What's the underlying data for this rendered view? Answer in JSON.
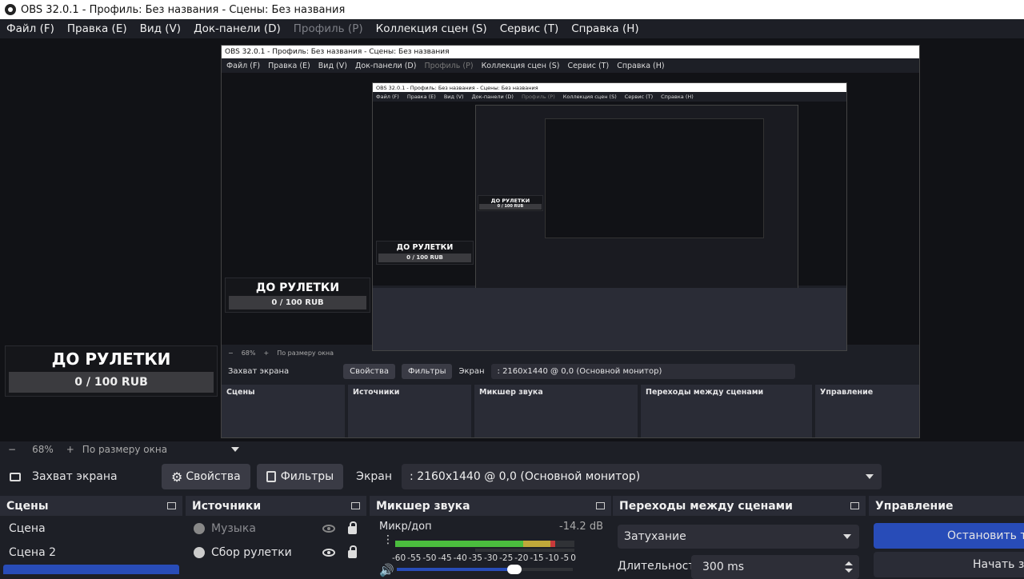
{
  "window": {
    "title": "OBS 32.0.1 - Профиль: Без названия - Сцены: Без названия"
  },
  "menu": [
    "Файл (F)",
    "Правка (E)",
    "Вид (V)",
    "Док-панели (D)",
    "Профиль (P)",
    "Коллекция сцен (S)",
    "Сервис (T)",
    "Справка (H)"
  ],
  "menu_disabled_index": 4,
  "overlay": {
    "heading": "ДО РУЛЕТКИ",
    "progress": "0 / 100 RUB"
  },
  "zoom": {
    "minus": "−",
    "value": "68%",
    "plus": "+",
    "mode": "По размеру окна"
  },
  "source_toolbar": {
    "source_name": "Захват экрана",
    "properties_label": "Свойства",
    "filters_label": "Фильтры",
    "screen_label": "Экран",
    "screen_value": ": 2160x1440 @ 0,0 (Основной монитор)"
  },
  "docks": {
    "scenes": {
      "title": "Сцены",
      "items": [
        "Сцена",
        "Сцена 2"
      ]
    },
    "sources": {
      "title": "Источники",
      "items": [
        {
          "label": "Музыка",
          "hidden": true
        },
        {
          "label": "Сбор рулетки",
          "hidden": false
        }
      ]
    },
    "mixer": {
      "title": "Микшер звука",
      "channel": "Микр/доп",
      "level": "-14.2 dB",
      "level_fraction": 0.78,
      "ticks": [
        "-60",
        "-55",
        "-50",
        "-45",
        "-40",
        "-35",
        "-30",
        "-25",
        "-20",
        "-15",
        "-10",
        "-5",
        "0"
      ]
    },
    "transitions": {
      "title": "Переходы между сценами",
      "type": "Затухание",
      "duration_label": "Длительность",
      "duration_value": "300 ms"
    },
    "controls": {
      "title": "Управление",
      "stop_label": "Остановить трансляцию",
      "start_label": "Начать запись"
    }
  },
  "colors": {
    "accent": "#284cb8",
    "background": "#1d1f26",
    "dock": "#2a2c36"
  }
}
